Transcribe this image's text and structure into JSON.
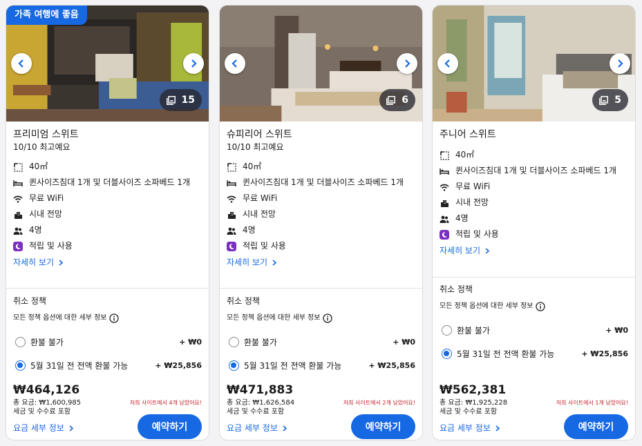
{
  "accent": "#1668e3",
  "urgency_color": "#c0202a",
  "cards": [
    {
      "badge": "가족 여행에 좋음",
      "photo_count": "15",
      "room_name": "프리미엄 스위트",
      "rating": "10/10 최고예요",
      "features": [
        {
          "icon": "area-icon",
          "text": "40㎡"
        },
        {
          "icon": "bed-icon",
          "text": "퀸사이즈침대 1개 및 더블사이즈 소파베드 1개"
        },
        {
          "icon": "wifi-icon",
          "text": "무료 WiFi"
        },
        {
          "icon": "city-icon",
          "text": "시내 전망"
        },
        {
          "icon": "people-icon",
          "text": "4명"
        },
        {
          "icon": "rewards-icon",
          "text": "적립 및 사용"
        }
      ],
      "details_link": "자세히 보기",
      "cancel_title": "취소 정책",
      "cancel_info": "모든 정책 옵션에 대한 세부 정보",
      "options": [
        {
          "label": "환불 불가",
          "amount": "+ ₩0",
          "selected": false
        },
        {
          "label": "5월 31일 전 전액 환불 가능",
          "amount": "+ ₩25,856",
          "selected": true
        }
      ],
      "price": "₩464,126",
      "total": "총 요금: ₩1,600,985",
      "tax": "세금 및 수수료 포함",
      "left_msg": "저희 사이트에서 4개 남았어요!",
      "fare_link": "요금 세부 정보",
      "book_label": "예약하기"
    },
    {
      "badge": "",
      "photo_count": "6",
      "room_name": "슈피리어 스위트",
      "rating": "10/10 최고예요",
      "features": [
        {
          "icon": "area-icon",
          "text": "40㎡"
        },
        {
          "icon": "bed-icon",
          "text": "퀸사이즈침대 1개 및 더블사이즈 소파베드 1개"
        },
        {
          "icon": "wifi-icon",
          "text": "무료 WiFi"
        },
        {
          "icon": "city-icon",
          "text": "시내 전망"
        },
        {
          "icon": "people-icon",
          "text": "4명"
        },
        {
          "icon": "rewards-icon",
          "text": "적립 및 사용"
        }
      ],
      "details_link": "자세히 보기",
      "cancel_title": "취소 정책",
      "cancel_info": "모든 정책 옵션에 대한 세부 정보",
      "options": [
        {
          "label": "환불 불가",
          "amount": "+ ₩0",
          "selected": false
        },
        {
          "label": "5월 31일 전 전액 환불 가능",
          "amount": "+ ₩25,856",
          "selected": true
        }
      ],
      "price": "₩471,883",
      "total": "총 요금: ₩1,626,584",
      "tax": "세금 및 수수료 포함",
      "left_msg": "저희 사이트에서 2개 남았어요!",
      "fare_link": "요금 세부 정보",
      "book_label": "예약하기"
    },
    {
      "badge": "",
      "photo_count": "5",
      "room_name": "주니어 스위트",
      "rating": "",
      "features": [
        {
          "icon": "area-icon",
          "text": "40㎡"
        },
        {
          "icon": "bed-icon",
          "text": "퀸사이즈침대 1개 및 더블사이즈 소파베드 1개"
        },
        {
          "icon": "wifi-icon",
          "text": "무료 WiFi"
        },
        {
          "icon": "city-icon",
          "text": "시내 전망"
        },
        {
          "icon": "people-icon",
          "text": "4명"
        },
        {
          "icon": "rewards-icon",
          "text": "적립 및 사용"
        }
      ],
      "details_link": "자세히 보기",
      "cancel_title": "취소 정책",
      "cancel_info": "모든 정책 옵션에 대한 세부 정보",
      "options": [
        {
          "label": "환불 불가",
          "amount": "+ ₩0",
          "selected": false
        },
        {
          "label": "5월 31일 전 전액 환불 가능",
          "amount": "+ ₩25,856",
          "selected": true
        }
      ],
      "price": "₩562,381",
      "total": "총 요금: ₩1,925,228",
      "tax": "세금 및 수수료 포함",
      "left_msg": "저희 사이트에서 1개 남았어요!",
      "fare_link": "요금 세부 정보",
      "book_label": "예약하기"
    }
  ]
}
